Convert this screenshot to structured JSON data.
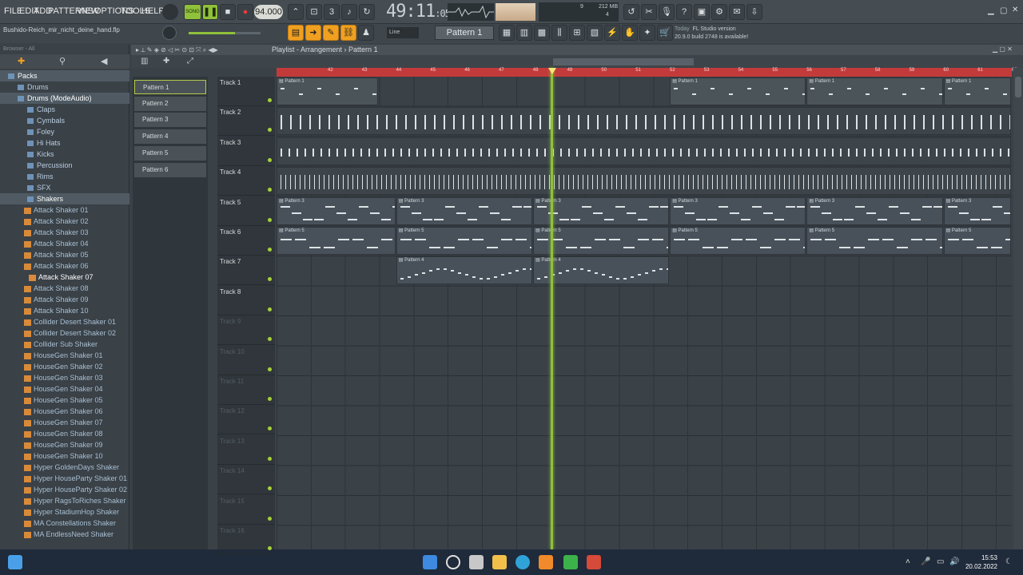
{
  "menu": [
    "FILE",
    "EDIT",
    "ADD",
    "PATTERNS",
    "VIEW",
    "OPTIONS",
    "TOOLS",
    "HELP"
  ],
  "transport": {
    "mode": "SONG",
    "tempo": "94.000",
    "time_main": "49:11",
    "time_sub": "05"
  },
  "cpu": {
    "value": "9",
    "memory": "212 MB",
    "poly": "4"
  },
  "file_name": "Bushido-Reich_mir_nicht_deine_hand.flp",
  "snap": "Line",
  "current_pattern": "Pattern 1",
  "news": {
    "day": "Today",
    "title": "FL Studio version",
    "body": "20.9.0 build 2748 is available!"
  },
  "browser": {
    "header": "Browser - All",
    "items": [
      {
        "label": "Packs",
        "kind": "folder",
        "indent": 0,
        "selected": true
      },
      {
        "label": "Drums",
        "kind": "folder",
        "indent": 1
      },
      {
        "label": "Drums (ModeAudio)",
        "kind": "folder",
        "indent": 1,
        "selected": true
      },
      {
        "label": "Claps",
        "kind": "folder",
        "indent": 2
      },
      {
        "label": "Cymbals",
        "kind": "folder",
        "indent": 2
      },
      {
        "label": "Foley",
        "kind": "folder",
        "indent": 2
      },
      {
        "label": "Hi Hats",
        "kind": "folder",
        "indent": 2
      },
      {
        "label": "Kicks",
        "kind": "folder",
        "indent": 2
      },
      {
        "label": "Percussion",
        "kind": "folder",
        "indent": 2
      },
      {
        "label": "Rims",
        "kind": "folder",
        "indent": 2
      },
      {
        "label": "SFX",
        "kind": "folder",
        "indent": 2
      },
      {
        "label": "Shakers",
        "kind": "folder",
        "indent": 2,
        "selected": true
      },
      {
        "label": "Attack Shaker 01",
        "kind": "file"
      },
      {
        "label": "Attack Shaker 02",
        "kind": "file"
      },
      {
        "label": "Attack Shaker 03",
        "kind": "file"
      },
      {
        "label": "Attack Shaker 04",
        "kind": "file"
      },
      {
        "label": "Attack Shaker 05",
        "kind": "file"
      },
      {
        "label": "Attack Shaker 06",
        "kind": "file"
      },
      {
        "label": "Attack Shaker 07",
        "kind": "file",
        "highlight": true
      },
      {
        "label": "Attack Shaker 08",
        "kind": "file"
      },
      {
        "label": "Attack Shaker 09",
        "kind": "file"
      },
      {
        "label": "Attack Shaker 10",
        "kind": "file"
      },
      {
        "label": "Collider Desert Shaker 01",
        "kind": "file"
      },
      {
        "label": "Collider Desert Shaker 02",
        "kind": "file"
      },
      {
        "label": "Collider Sub Shaker",
        "kind": "file"
      },
      {
        "label": "HouseGen Shaker 01",
        "kind": "file"
      },
      {
        "label": "HouseGen Shaker 02",
        "kind": "file"
      },
      {
        "label": "HouseGen Shaker 03",
        "kind": "file"
      },
      {
        "label": "HouseGen Shaker 04",
        "kind": "file"
      },
      {
        "label": "HouseGen Shaker 05",
        "kind": "file"
      },
      {
        "label": "HouseGen Shaker 06",
        "kind": "file"
      },
      {
        "label": "HouseGen Shaker 07",
        "kind": "file"
      },
      {
        "label": "HouseGen Shaker 08",
        "kind": "file"
      },
      {
        "label": "HouseGen Shaker 09",
        "kind": "file"
      },
      {
        "label": "HouseGen Shaker 10",
        "kind": "file"
      },
      {
        "label": "Hyper GoldenDays Shaker",
        "kind": "file"
      },
      {
        "label": "Hyper HouseParty Shaker 01",
        "kind": "file"
      },
      {
        "label": "Hyper HouseParty Shaker 02",
        "kind": "file"
      },
      {
        "label": "Hyper RagsToRiches Shaker",
        "kind": "file"
      },
      {
        "label": "Hyper StadiumHop Shaker",
        "kind": "file"
      },
      {
        "label": "MA Constellations Shaker",
        "kind": "file"
      },
      {
        "label": "MA EndlessNeed Shaker",
        "kind": "file"
      }
    ]
  },
  "playlist": {
    "title": "Playlist - Arrangement",
    "crumb": "Pattern 1",
    "patterns": [
      "Pattern 1",
      "Pattern 2",
      "Pattern 3",
      "Pattern 4",
      "Pattern 5",
      "Pattern 6"
    ],
    "tracks": [
      "Track 1",
      "Track 2",
      "Track 3",
      "Track 4",
      "Track 5",
      "Track 6",
      "Track 7",
      "Track 8",
      "Track 9",
      "Track 10",
      "Track 11",
      "Track 12",
      "Track 13",
      "Track 14",
      "Track 15",
      "Track 16"
    ],
    "ruler": [
      "42",
      "43",
      "44",
      "45",
      "46",
      "47",
      "48",
      "49",
      "50",
      "51",
      "52",
      "53",
      "54",
      "55",
      "56",
      "57",
      "58",
      "59",
      "60",
      "61",
      "62"
    ]
  },
  "clock": {
    "time": "15:53",
    "date": "20.02.2022"
  }
}
